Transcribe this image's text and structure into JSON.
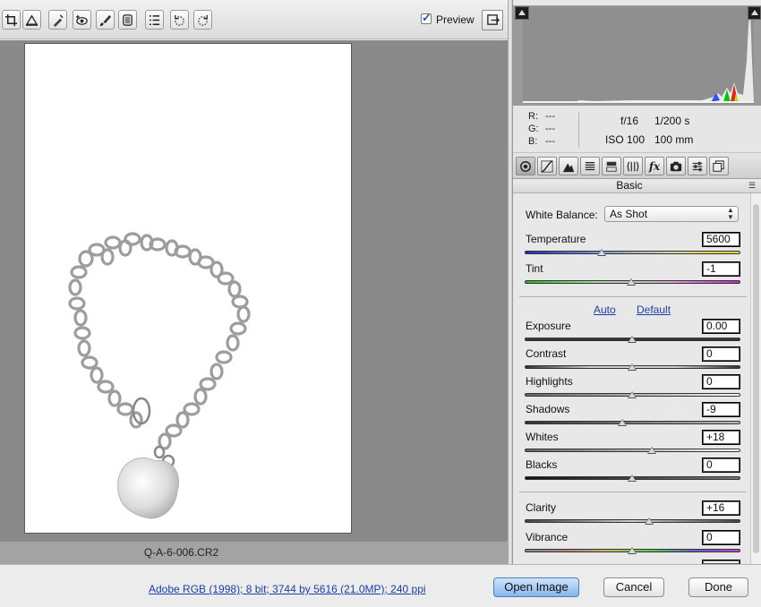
{
  "toolbar": {
    "tools": [
      {
        "name": "crop-tool-icon",
        "glyph": "⌗"
      },
      {
        "name": "straighten-tool-icon",
        "glyph": "△"
      },
      {
        "name": "spot-removal-tool-icon",
        "glyph": "✎"
      },
      {
        "name": "red-eye-tool-icon",
        "glyph": "◉"
      },
      {
        "name": "adjustment-brush-icon",
        "glyph": "✐"
      },
      {
        "name": "graduated-filter-icon",
        "glyph": "▥"
      },
      {
        "name": "preferences-icon",
        "glyph": "☰"
      },
      {
        "name": "rotate-left-icon",
        "glyph": "↺"
      },
      {
        "name": "rotate-right-icon",
        "glyph": "↻"
      }
    ],
    "preview_label": "Preview",
    "preview_checked": true
  },
  "image": {
    "filename": "Q-A-6-006.CR2"
  },
  "info": {
    "r_label": "R:",
    "g_label": "G:",
    "b_label": "B:",
    "r_value": "---",
    "g_value": "---",
    "b_value": "---",
    "aperture": "f/16",
    "shutter": "1/200 s",
    "iso": "ISO 100",
    "focal_length": "100 mm"
  },
  "panel": {
    "title": "Basic",
    "white_balance_label": "White Balance:",
    "white_balance_value": "As Shot",
    "auto_label": "Auto",
    "default_label": "Default",
    "sliders": {
      "temperature": {
        "label": "Temperature",
        "value": "5600"
      },
      "tint": {
        "label": "Tint",
        "value": "-1"
      },
      "exposure": {
        "label": "Exposure",
        "value": "0.00"
      },
      "contrast": {
        "label": "Contrast",
        "value": "0"
      },
      "highlights": {
        "label": "Highlights",
        "value": "0"
      },
      "shadows": {
        "label": "Shadows",
        "value": "-9"
      },
      "whites": {
        "label": "Whites",
        "value": "+18"
      },
      "blacks": {
        "label": "Blacks",
        "value": "0"
      },
      "clarity": {
        "label": "Clarity",
        "value": "+16"
      },
      "vibrance": {
        "label": "Vibrance",
        "value": "0"
      }
    }
  },
  "footer": {
    "workflow_options": "Adobe RGB (1998); 8 bit; 3744 by 5616 (21.0MP); 240 ppi",
    "open_image_label": "Open Image",
    "cancel_label": "Cancel",
    "done_label": "Done"
  }
}
